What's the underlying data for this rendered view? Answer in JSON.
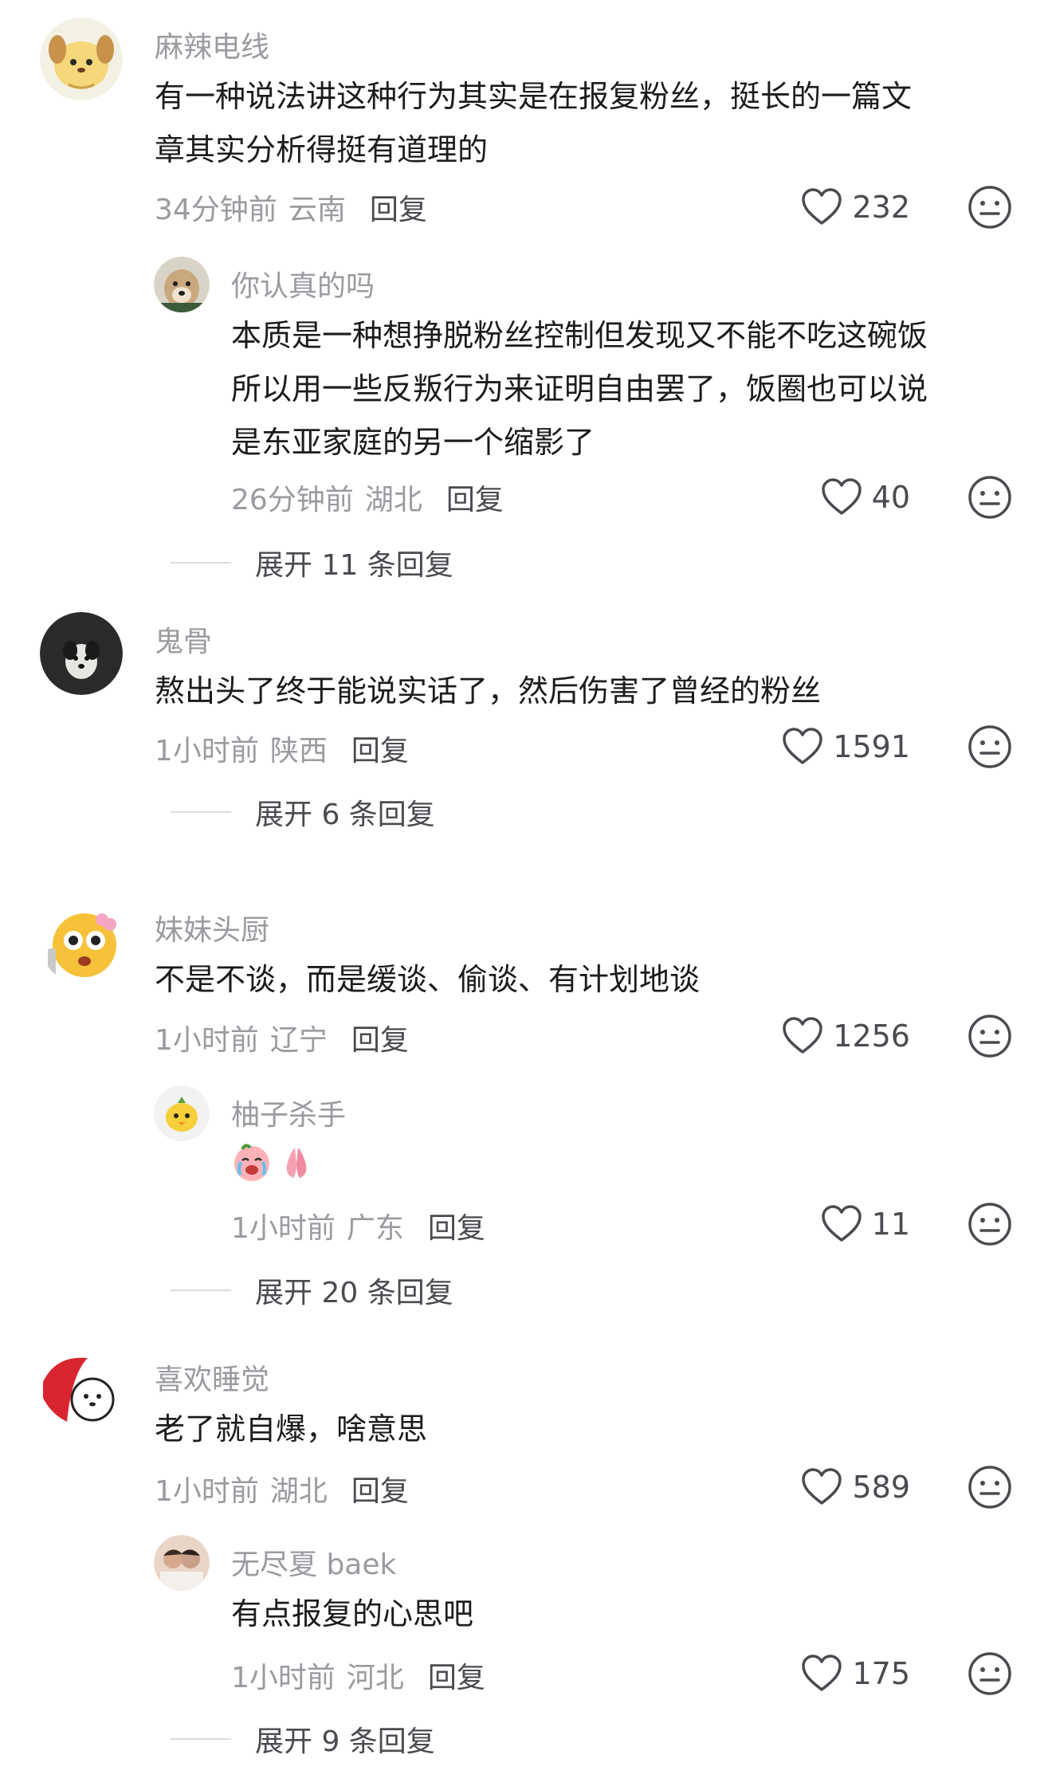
{
  "comments": [
    {
      "username": "麻辣电线",
      "content_lines": [
        "有一种说法讲这种行为其实是在报复粉丝，挺长的一篇文",
        "章其实分析得挺有道理的"
      ],
      "time": "34分钟前",
      "location": "云南",
      "reply_label": "回复",
      "likes": "232",
      "replies": [
        {
          "username": "你认真的吗",
          "content_lines": [
            "本质是一种想挣脱粉丝控制但发现又不能不吃这碗饭",
            "所以用一些反叛行为来证明自由罢了，饭圈也可以说",
            "是东亚家庭的另一个缩影了"
          ],
          "time": "26分钟前",
          "location": "湖北",
          "reply_label": "回复",
          "likes": "40"
        }
      ],
      "expand_label": "展开 11 条回复"
    },
    {
      "username": "鬼骨",
      "content_lines": [
        "熬出头了终于能说实话了，然后伤害了曾经的粉丝"
      ],
      "time": "1小时前",
      "location": "陕西",
      "reply_label": "回复",
      "likes": "1591",
      "expand_label": "展开 6 条回复"
    },
    {
      "username": "妹妹头厨",
      "content_lines": [
        "不是不谈，而是缓谈、偷谈、有计划地谈"
      ],
      "time": "1小时前",
      "location": "辽宁",
      "reply_label": "回复",
      "likes": "1256",
      "replies": [
        {
          "username": "柚子杀手",
          "emoji": [
            "crying-emoji",
            "pray-emoji"
          ],
          "time": "1小时前",
          "location": "广东",
          "reply_label": "回复",
          "likes": "11"
        }
      ],
      "expand_label": "展开 20 条回复"
    },
    {
      "username": "喜欢睡觉",
      "content_lines": [
        "老了就自爆，啥意思"
      ],
      "time": "1小时前",
      "location": "湖北",
      "reply_label": "回复",
      "likes": "589",
      "replies": [
        {
          "username": "无尽夏 baek",
          "content_lines": [
            "有点报复的心思吧"
          ],
          "time": "1小时前",
          "location": "河北",
          "reply_label": "回复",
          "likes": "175"
        }
      ],
      "expand_label": "展开 9 条回复"
    }
  ],
  "colors": {
    "meta_gray": "#9a9aa0",
    "text_dark": "#1c1c1e",
    "action_gray": "#4a4a50"
  },
  "icons": {
    "like": "heart-outline-icon",
    "dislike": "neutral-face-icon"
  }
}
